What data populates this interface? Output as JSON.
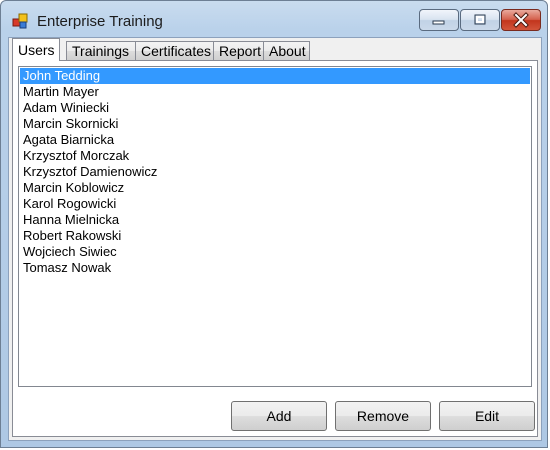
{
  "window": {
    "title": "Enterprise Training",
    "accent": "#3399ff"
  },
  "tabs": [
    {
      "label": "Users",
      "active": true
    },
    {
      "label": "Trainings",
      "active": false
    },
    {
      "label": "Certificates",
      "active": false
    },
    {
      "label": "Report",
      "active": false
    },
    {
      "label": "About",
      "active": false
    }
  ],
  "users": {
    "selected_index": 0,
    "items": [
      "John Tedding",
      "Martin Mayer",
      "Adam Winiecki",
      "Marcin Skornicki",
      "Agata Biarnicka",
      "Krzysztof Morczak",
      "Krzysztof Damienowicz",
      "Marcin Koblowicz",
      "Karol Rogowicki",
      "Hanna Mielnicka",
      "Robert Rakowski",
      "Wojciech Siwiec",
      "Tomasz Nowak"
    ]
  },
  "actions": {
    "add_label": "Add",
    "remove_label": "Remove",
    "edit_label": "Edit"
  }
}
